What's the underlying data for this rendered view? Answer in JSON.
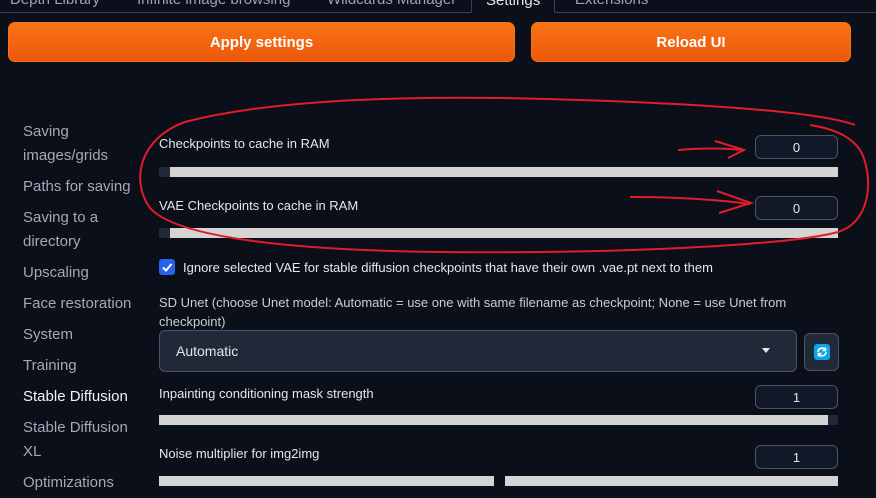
{
  "tabs": [
    {
      "label": "Depth Library"
    },
    {
      "label": "Infinite image browsing"
    },
    {
      "label": "Wildcards Manager"
    },
    {
      "label": "Settings"
    },
    {
      "label": "Extensions"
    }
  ],
  "buttons": {
    "apply": "Apply settings",
    "reload": "Reload UI"
  },
  "sidebar": {
    "items": [
      {
        "label": "Saving images/grids"
      },
      {
        "label": "Paths for saving"
      },
      {
        "label": "Saving to a directory"
      },
      {
        "label": "Upscaling"
      },
      {
        "label": "Face restoration"
      },
      {
        "label": "System"
      },
      {
        "label": "Training"
      },
      {
        "label": "Stable Diffusion"
      },
      {
        "label": "Stable Diffusion XL"
      },
      {
        "label": "Optimizations"
      }
    ],
    "active": "Stable Diffusion"
  },
  "settings": {
    "checkpoints_cache": {
      "label": "Checkpoints to cache in RAM",
      "value": "0"
    },
    "vae_cache": {
      "label": "VAE Checkpoints to cache in RAM",
      "value": "0"
    },
    "ignore_vae": {
      "label": "Ignore selected VAE for stable diffusion checkpoints that have their own .vae.pt next to them",
      "checked": true
    },
    "sd_unet": {
      "label": "SD Unet (choose Unet model: Automatic = use one with same filename as checkpoint; None = use Unet from checkpoint)",
      "value": "Automatic"
    },
    "inpainting_mask": {
      "label": "Inpainting conditioning mask strength",
      "value": "1"
    },
    "noise_multiplier": {
      "label": "Noise multiplier for img2img",
      "value": "1"
    }
  },
  "colors": {
    "accent": "#f97316",
    "background": "#0b0f19",
    "annotation": "#e11d2a"
  }
}
